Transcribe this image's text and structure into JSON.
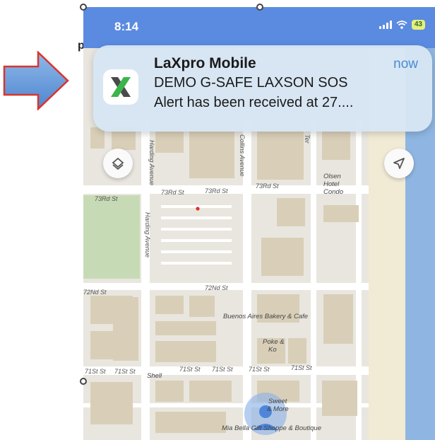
{
  "status_bar": {
    "time": "8:14",
    "battery": "43",
    "icons": [
      "signal-icon",
      "wifi-icon",
      "battery-icon"
    ]
  },
  "notification": {
    "app_name": "LaXpro Mobile",
    "time": "now",
    "line1": "DEMO G-SAFE LAXSON SOS",
    "line2": "Alert  has been received at  27....",
    "icon": "laxpro-app-icon"
  },
  "stray_glyph": "p",
  "map": {
    "streets": {
      "harding_avenue_top": "Harding Avenue",
      "harding_avenue_lower": "Harding Avenue",
      "collins_avenue": "Collins Avenue",
      "terrace": "Ter",
      "73rd_left": "73Rd St",
      "73rd_mid": "73Rd St",
      "73rd_mid2": "73Rd St",
      "73rd_right": "73Rd St",
      "72nd_left": "72Nd St",
      "72nd_mid": "72Nd St",
      "71st_1": "71St St",
      "71st_2": "71St St",
      "71st_3": "71St St",
      "71st_4": "71St St",
      "71st_5": "71St St",
      "71st_6": "71St St"
    },
    "pois": {
      "olsen_hotel_1": "Olsen",
      "olsen_hotel_2": "Hotel",
      "olsen_hotel_3": "Condo",
      "buenos_aires": "Buenos Aires Bakery & Cafe",
      "poke_1": "Poke &",
      "poke_2": "Ko",
      "shell": "Shell",
      "sweet_1": "Sweet",
      "sweet_2": "& More",
      "mia_bella": "Mia Bella Gift Shoppe & Boutique"
    },
    "colors": {
      "land": "#e9e6df",
      "road": "#ffffff",
      "building": "#d9cfb8",
      "park": "#c6dbb5",
      "water": "#8fb6e2",
      "beach": "#f1ead5",
      "marker": "#e0322a"
    }
  },
  "colors": {
    "status_bar": "#5b8be0",
    "notification_bg": "#d6e6f4",
    "accent": "#4a8bd1",
    "arrow_fill": "#6fa2de",
    "arrow_stroke": "#d9342b"
  }
}
